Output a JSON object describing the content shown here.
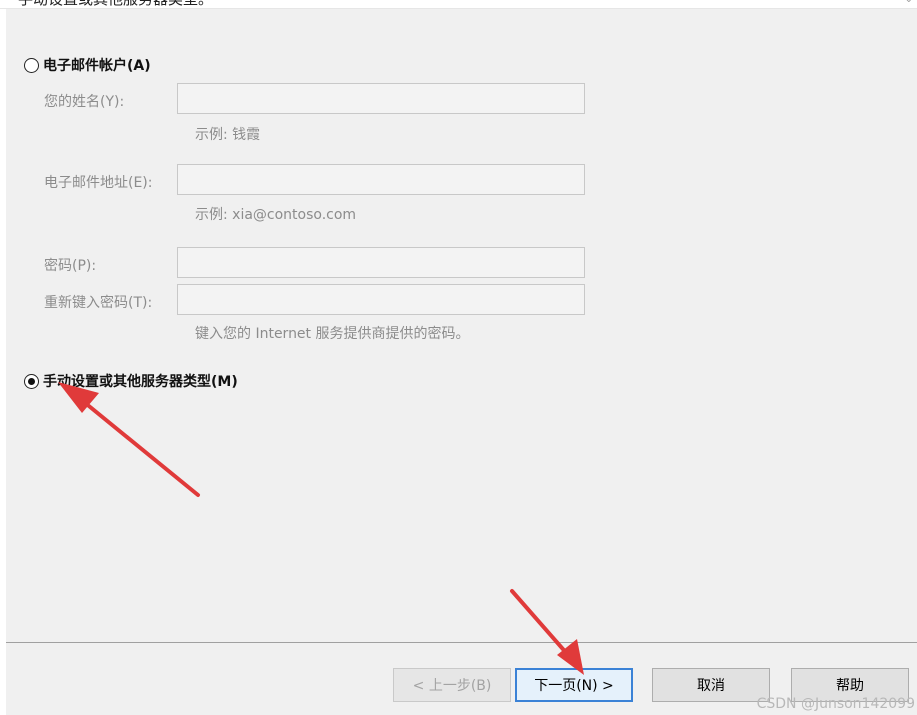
{
  "header": {
    "clipped_text": "手动设置或其他服务器类型。"
  },
  "email_account": {
    "radio_label": "电子邮件帐户(A)",
    "selected": false,
    "fields": {
      "name": {
        "label": "您的姓名(Y):",
        "value": "",
        "hint": "示例: 钱霞"
      },
      "email": {
        "label": "电子邮件地址(E):",
        "value": "",
        "hint": "示例: xia@contoso.com"
      },
      "password": {
        "label": "密码(P):",
        "value": ""
      },
      "retype_password": {
        "label": "重新键入密码(T):",
        "value": "",
        "hint": "键入您的 Internet 服务提供商提供的密码。"
      }
    }
  },
  "manual_setup": {
    "radio_label": "手动设置或其他服务器类型(M)",
    "selected": true
  },
  "buttons": {
    "back": "< 上一步(B)",
    "next": "下一页(N) >",
    "cancel": "取消",
    "help": "帮助"
  },
  "watermark": "CSDN @Junson142099",
  "colors": {
    "panel_bg": "#f0f0f0",
    "disabled_text": "#8c8c8c",
    "annotation_arrow": "#e03a3a",
    "primary_border": "#3b82d6"
  }
}
